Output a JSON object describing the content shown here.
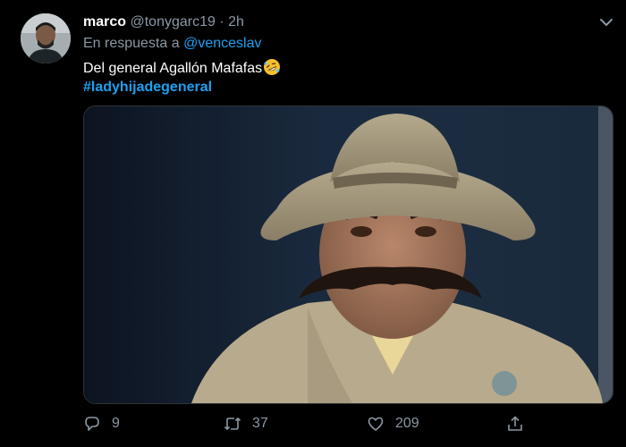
{
  "tweet": {
    "author": {
      "display_name": "marco",
      "handle": "@tonygarc19",
      "separator": "·",
      "time": "2h"
    },
    "reply": {
      "prefix": "En respuesta a",
      "mention": "@venceslav"
    },
    "text": "Del general Agallón Mafafas",
    "emoji": "rolling-on-floor-laughing-emoji",
    "hashtag": "#ladyhijadegeneral",
    "media": {
      "type": "video-still"
    },
    "actions": {
      "replies": "9",
      "retweets": "37",
      "likes": "209"
    }
  },
  "colors": {
    "background": "#000000",
    "text": "#ffffff",
    "muted": "#8b98a5",
    "link": "#1da1f2"
  },
  "icons": [
    "chevron-down-icon",
    "reply-icon",
    "retweet-icon",
    "like-icon",
    "share-icon"
  ]
}
